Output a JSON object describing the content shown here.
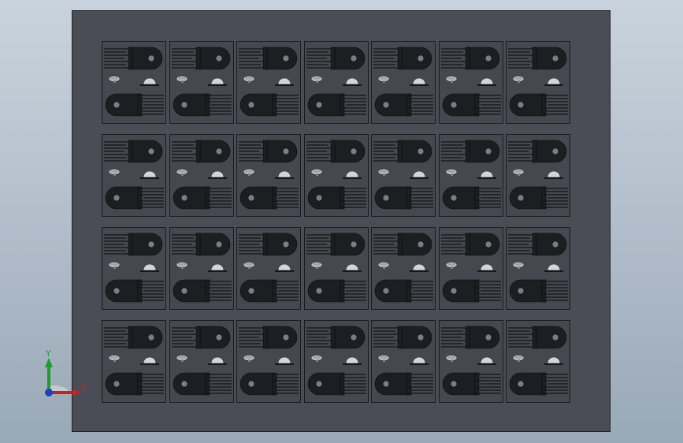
{
  "part_array": {
    "rows": 4,
    "columns": 7
  },
  "triad": {
    "x_label": "X",
    "y_label": "Y",
    "x_color": "#c42323",
    "y_color": "#1f9c2d",
    "z_color": "#1f3fbf"
  },
  "colors": {
    "plate": "#4a4d55",
    "part": "#1d1e21",
    "background_top": "#c9d3dd",
    "background_bottom": "#9aa9b7"
  }
}
